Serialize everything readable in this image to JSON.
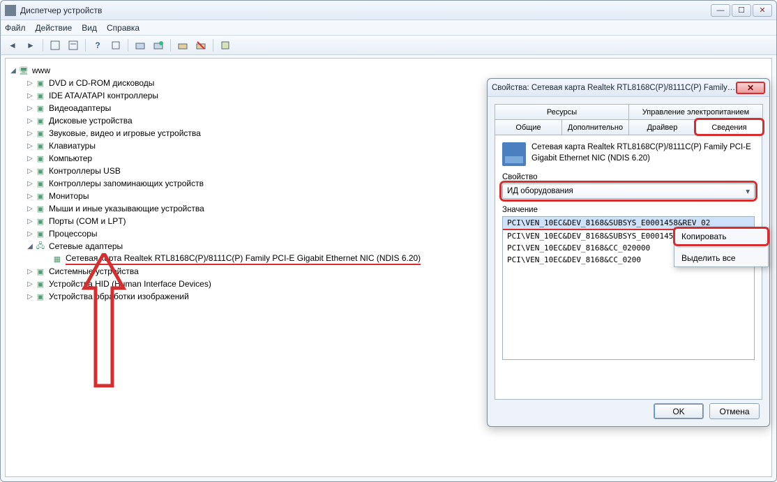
{
  "window": {
    "title": "Диспетчер устройств"
  },
  "menubar": {
    "file": "Файл",
    "action": "Действие",
    "view": "Вид",
    "help": "Справка"
  },
  "tree": {
    "root": "www",
    "items": [
      "DVD и CD-ROM дисководы",
      "IDE ATA/ATAPI контроллеры",
      "Видеоадаптеры",
      "Дисковые устройства",
      "Звуковые, видео и игровые устройства",
      "Клавиатуры",
      "Компьютер",
      "Контроллеры USB",
      "Контроллеры запоминающих устройств",
      "Мониторы",
      "Мыши и иные указывающие устройства",
      "Порты (COM и LPT)",
      "Процессоры"
    ],
    "net_adapters": "Сетевые адаптеры",
    "net_adapter_item": "Сетевая карта Realtek RTL8168C(P)/8111C(P) Family PCI-E Gigabit Ethernet NIC (NDIS 6.20)",
    "items_after": [
      "Системные устройства",
      "Устройства HID (Human Interface Devices)",
      "Устройства обработки изображений"
    ]
  },
  "dialog": {
    "title": "Свойства: Сетевая карта Realtek RTL8168C(P)/8111C(P) Family ...",
    "tabs_row1": {
      "resources": "Ресурсы",
      "power": "Управление электропитанием"
    },
    "tabs_row2": {
      "general": "Общие",
      "advanced": "Дополнительно",
      "driver": "Драйвер",
      "details": "Сведения"
    },
    "device_name_line1": "Сетевая карта Realtek RTL8168C(P)/8111C(P) Family PCI-E",
    "device_name_line2": "Gigabit Ethernet NIC (NDIS 6.20)",
    "property_label": "Свойство",
    "property_value": "ИД оборудования",
    "value_label": "Значение",
    "values": [
      "PCI\\VEN_10EC&DEV_8168&SUBSYS_E0001458&REV_02",
      "PCI\\VEN_10EC&DEV_8168&SUBSYS_E0001458",
      "PCI\\VEN_10EC&DEV_8168&CC_020000",
      "PCI\\VEN_10EC&DEV_8168&CC_0200"
    ],
    "ok": "OK",
    "cancel": "Отмена"
  },
  "context_menu": {
    "copy": "Копировать",
    "select_all": "Выделить все"
  }
}
